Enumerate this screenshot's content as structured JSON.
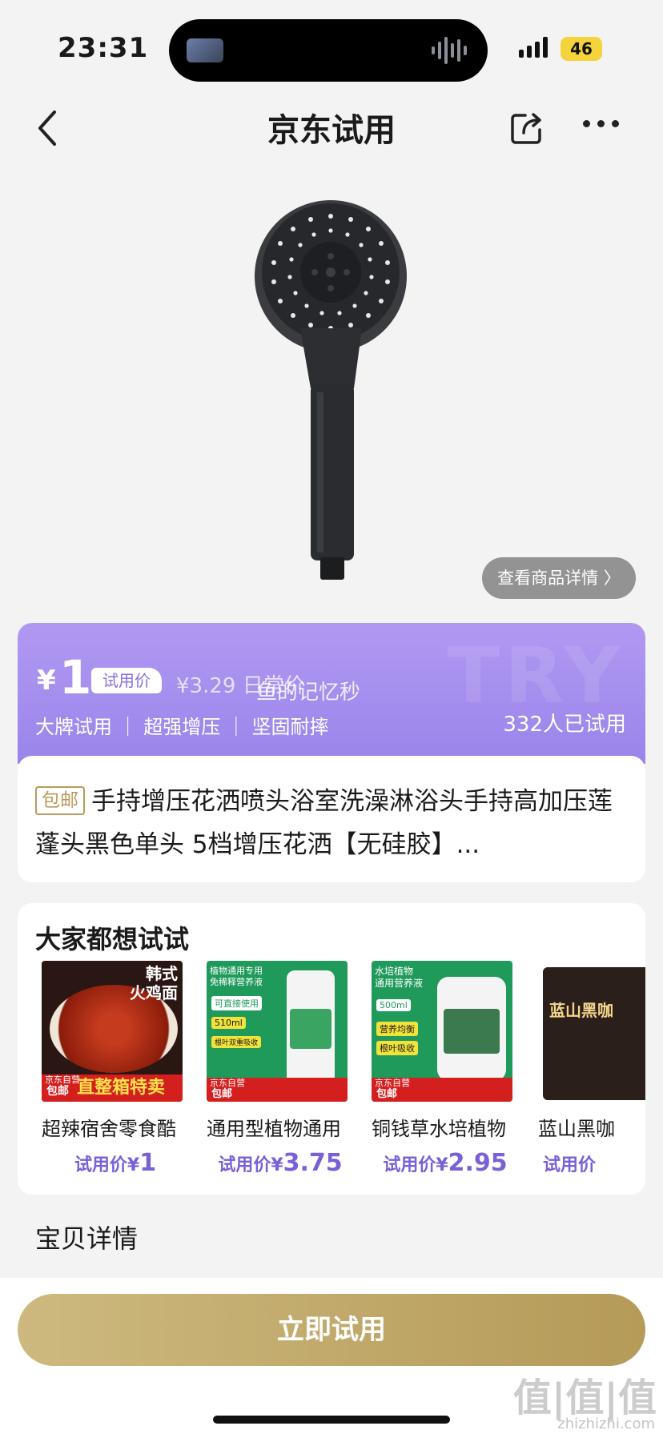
{
  "status_bar": {
    "time": "23:31",
    "battery": "46"
  },
  "nav": {
    "title": "京东试用"
  },
  "product": {
    "detail_link": "查看商品详情 〉",
    "price_symbol": "¥",
    "price": "1",
    "trial_tag": "试用价",
    "original_price": "¥3.29 日常价",
    "watermark_text": "鱼的记忆秒",
    "banner_watermark": "TRY",
    "tags": "大牌试用 ｜ 超强增压 ｜ 坚固耐摔",
    "trial_count": "332人已试用",
    "free_shipping": "包邮",
    "title": "手持增压花洒喷头浴室洗澡淋浴头手持高加压莲蓬头黑色单头 5档增压花洒【无硅胶】..."
  },
  "recommend": {
    "title": "大家都想试试",
    "items": [
      {
        "name": "超辣宿舍零食酷",
        "price_prefix": "试用价¥",
        "price": "1",
        "img_top": "韩式\n火鸡面",
        "img_badge": "包邮",
        "img_banner": "直整箱特卖",
        "img_logo": "京东自营"
      },
      {
        "name": "通用型植物通用",
        "price_prefix": "试用价¥",
        "price": "3.75",
        "img_top": "植物通用专用\n免稀释营养液",
        "img_badge": "包邮",
        "img_tag1": "可直接使用",
        "img_tag2": "510ml",
        "img_tag3": "根叶双重吸收",
        "img_logo": "京东自营"
      },
      {
        "name": "铜钱草水培植物",
        "price_prefix": "试用价¥",
        "price": "2.95",
        "img_top": "水培植物\n通用营养液",
        "img_badge": "包邮",
        "img_tag1": "500ml",
        "img_tag2": "营养均衡",
        "img_tag3": "根叶吸收",
        "img_logo": "京东自营"
      },
      {
        "name": "蓝山黑咖",
        "price_prefix": "试用价",
        "price": "",
        "img_top": "蓝山黑咖"
      }
    ]
  },
  "detail_section": "宝贝详情",
  "cta": "立即试用",
  "site_watermark": "值|值|值",
  "site_watermark_sub": "zhizhizhi.com",
  "colors": {
    "accent_purple": "#9a84ea",
    "cta_gold": "#c2a866",
    "price_purple": "#7a5fd6"
  }
}
